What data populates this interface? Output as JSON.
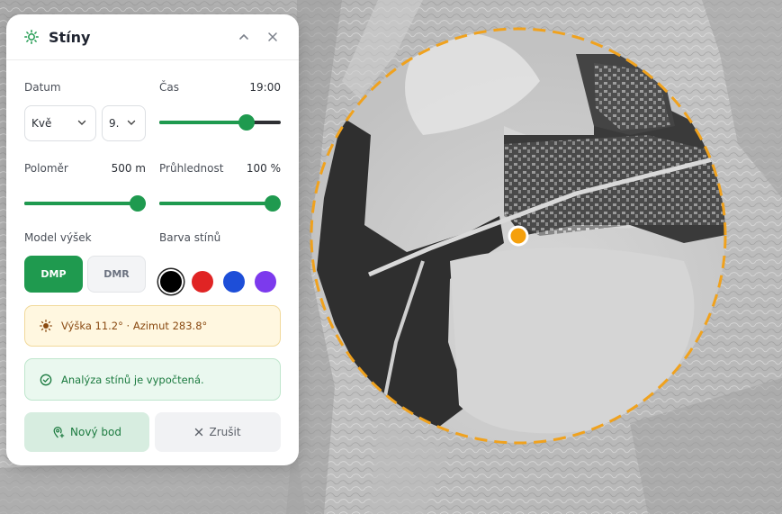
{
  "map": {
    "center_marker_color": "#f5a00c",
    "radius_circle_color": "#f0a21e"
  },
  "panel": {
    "title": "Stíny",
    "icons": {
      "title": "sun-settings-icon",
      "collapse": "chevron-up-icon",
      "close": "close-icon"
    },
    "date": {
      "label": "Datum",
      "month": "Kvě",
      "day": "9."
    },
    "time": {
      "label": "Čas",
      "value": "19:00",
      "level": 0.75
    },
    "radius": {
      "label": "Poloměr",
      "value": "500 m",
      "level": 1.0
    },
    "opacity": {
      "label": "Průhlednost",
      "value": "100 %",
      "level": 1.0
    },
    "model": {
      "label": "Model výšek",
      "options": [
        "DMP",
        "DMR"
      ],
      "selected": "DMP"
    },
    "shadow_color": {
      "label": "Barva stínů",
      "swatches": [
        "#000000",
        "#e02424",
        "#1d4ed8",
        "#7c3aed"
      ],
      "selected": "#000000"
    },
    "sun_info": "Výška 11.2° · Azimut 283.8°",
    "status": "Analýza stínů je vypočtená.",
    "buttons": {
      "new_point": "Nový bod",
      "cancel": "Zrušit"
    },
    "accent": "#1f9a4f"
  }
}
